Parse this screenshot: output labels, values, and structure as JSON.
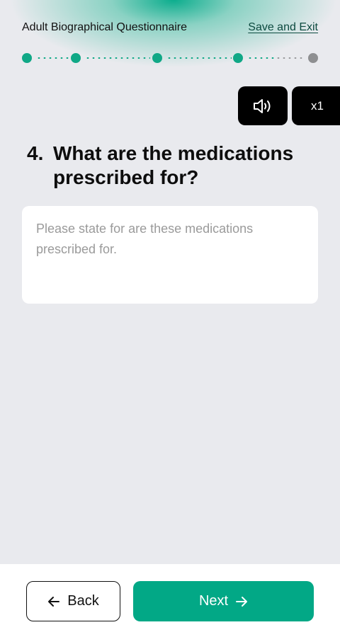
{
  "header": {
    "title": "Adult Biographical Questionnaire",
    "save_exit_label": "Save and Exit"
  },
  "progress": {
    "total_steps": 5,
    "completed_steps": 4
  },
  "controls": {
    "audio_icon": "speaker-icon",
    "speed_label": "x1"
  },
  "question": {
    "number": "4.",
    "text": "What are the medications prescribed for?"
  },
  "answer": {
    "value": "",
    "placeholder": "Please state for are these medications prescribed for."
  },
  "footer": {
    "back_label": "Back",
    "next_label": "Next",
    "back_icon": "arrow-left-icon",
    "next_icon": "arrow-right-icon"
  },
  "colors": {
    "accent": "#02a886",
    "progress_inactive": "#8e8f91",
    "background": "#e9eaee"
  }
}
